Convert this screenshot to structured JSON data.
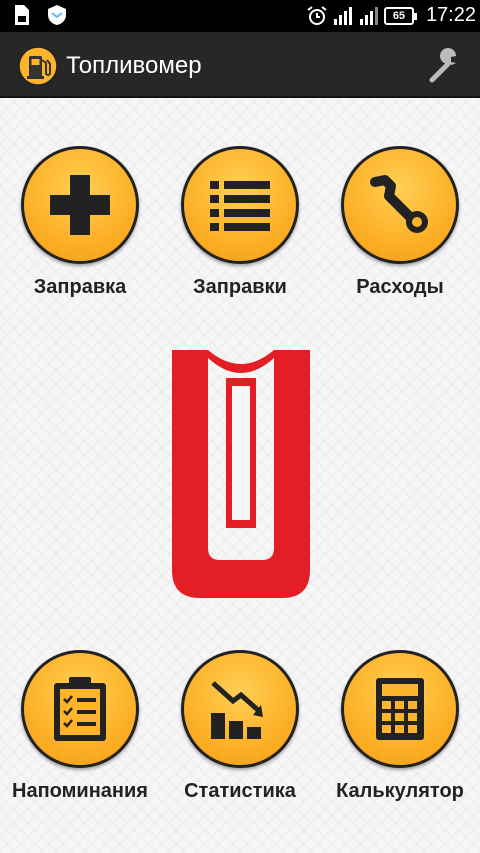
{
  "status_bar": {
    "time": "17:22",
    "battery": "65",
    "icons": [
      "sd-card-icon",
      "shield-app-icon",
      "alarm-icon",
      "signal-icon",
      "signal-2-icon",
      "battery-icon"
    ]
  },
  "action_bar": {
    "title": "Топливомер",
    "app_icon": "fuel-pump-icon",
    "settings_icon": "wrench-icon"
  },
  "top_tiles": [
    {
      "label": "Заправка",
      "icon": "plus-icon"
    },
    {
      "label": "Заправки",
      "icon": "list-icon"
    },
    {
      "label": "Расходы",
      "icon": "wrench-icon"
    }
  ],
  "bottom_tiles": [
    {
      "label": "Напоминания",
      "icon": "clipboard-checklist-icon"
    },
    {
      "label": "Статистика",
      "icon": "chart-decline-icon"
    },
    {
      "label": "Калькулятор",
      "icon": "calculator-icon"
    }
  ],
  "colors": {
    "accent": "#fdb32a",
    "logo_red": "#e31e24",
    "action_bar": "#272727",
    "status_bar": "#000000"
  },
  "logo": "car-brand-logo"
}
